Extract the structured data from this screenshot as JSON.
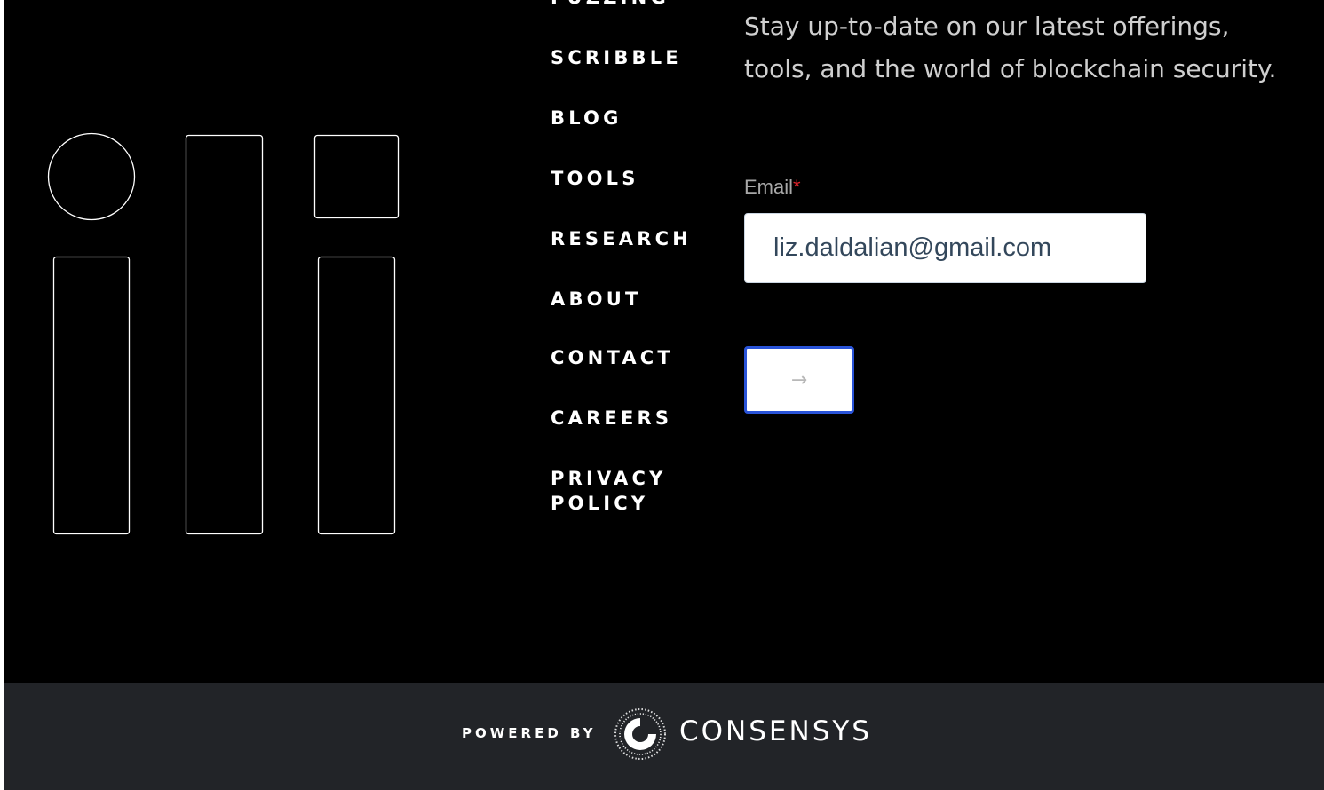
{
  "nav": {
    "cut_off_item": "FUZZING",
    "items": [
      "SCRIBBLE",
      "BLOG",
      "TOOLS",
      "RESEARCH",
      "ABOUT",
      "CONTACT",
      "CAREERS",
      "PRIVACY POLICY"
    ]
  },
  "signup": {
    "intro": "Stay up-to-date on our latest offerings, tools, and the world of blockchain security.",
    "email_label": "Email",
    "required_mark": "*",
    "email_value": "liz.daldalian@gmail.com",
    "submit_label": "→"
  },
  "footer": {
    "powered_by": "POWERED BY",
    "brand_name": "CONSENSYS",
    "brand_icon": "consensys-logo-icon"
  },
  "colors": {
    "background": "#000000",
    "footer_background": "#222428",
    "button_border": "#2a54d9",
    "required_mark": "#e0242c"
  }
}
